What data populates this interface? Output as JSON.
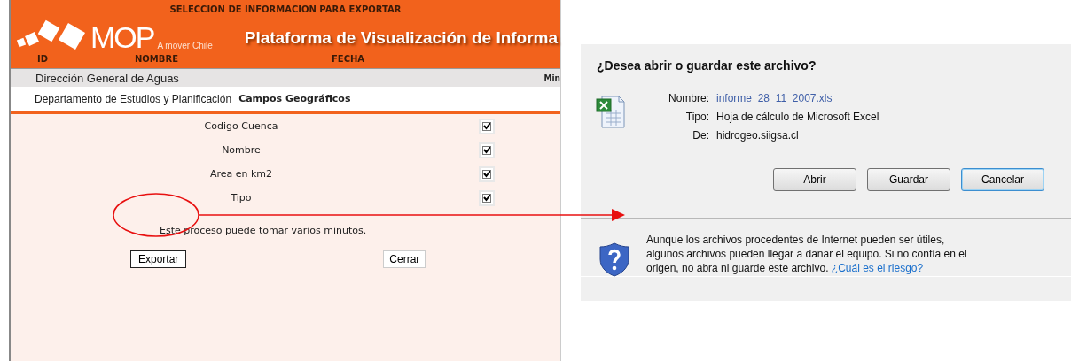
{
  "export_window": {
    "title": "SELECCION DE INFORMACION PARA EXPORTAR",
    "logo_text": "MOP",
    "logo_tagline": "A mover Chile",
    "banner_title": "Plataforma de Visualización de Informa",
    "columns": [
      "ID",
      "NOMBRE",
      "FECHA"
    ],
    "agency": "Dirección General de Aguas",
    "agency_right": "Min",
    "department": "Departamento de Estudios y Planificación",
    "section_title": "Campos Geográficos",
    "fields": [
      {
        "label": "Codigo Cuenca",
        "checked": true
      },
      {
        "label": "Nombre",
        "checked": true
      },
      {
        "label": "Area en km2",
        "checked": true
      },
      {
        "label": "Tipo",
        "checked": true
      }
    ],
    "note": "Este proceso puede tomar varios minutos.",
    "buttons": [
      "Exportar",
      "Cerrar"
    ]
  },
  "download_dialog": {
    "question": "¿Desea abrir o guardar este archivo?",
    "details": [
      {
        "label": "Nombre:",
        "value": "informe_28_11_2007.xls",
        "kind": "link"
      },
      {
        "label": "Tipo:",
        "value": "Hoja de cálculo de Microsoft Excel",
        "kind": "text"
      },
      {
        "label": "De:",
        "value": "hidrogeo.siigsa.cl",
        "kind": "text"
      }
    ],
    "buttons": [
      {
        "label": "Abrir",
        "focused": false
      },
      {
        "label": "Guardar",
        "focused": false
      },
      {
        "label": "Cancelar",
        "focused": true
      }
    ],
    "warning": "Aunque los archivos procedentes de Internet pueden ser útiles, algunos archivos pueden llegar a dañar el equipo. Si no confía en el origen, no abra ni guarde este archivo.",
    "risk_link": "¿Cuál es el riesgo?"
  }
}
